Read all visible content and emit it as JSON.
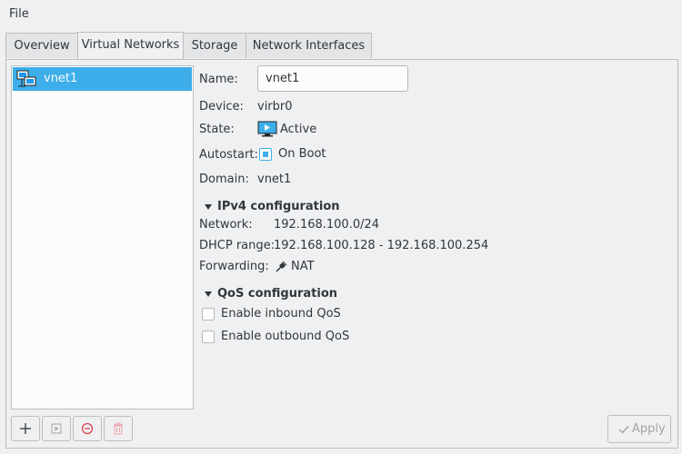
{
  "menubar": {
    "file": "File"
  },
  "tabs": [
    {
      "label": "Overview"
    },
    {
      "label": "Virtual Networks"
    },
    {
      "label": "Storage"
    },
    {
      "label": "Network Interfaces"
    }
  ],
  "networks": [
    {
      "name": "vnet1",
      "icon": "network-icon"
    }
  ],
  "details": {
    "name_label": "Name:",
    "name_value": "vnet1",
    "device_label": "Device:",
    "device_value": "virbr0",
    "state_label": "State:",
    "state_value": "Active",
    "autostart_label": "Autostart:",
    "autostart_value": "On Boot",
    "autostart_checked": true,
    "domain_label": "Domain:",
    "domain_value": "vnet1"
  },
  "ipv4": {
    "heading": "IPv4 configuration",
    "network_label": "Network:",
    "network_value": "192.168.100.0/24",
    "dhcp_label": "DHCP range:",
    "dhcp_value": "192.168.100.128 - 192.168.100.254",
    "forwarding_label": "Forwarding:",
    "forwarding_value": "NAT"
  },
  "qos": {
    "heading": "QoS configuration",
    "inbound_label": "Enable inbound QoS",
    "outbound_label": "Enable outbound QoS"
  },
  "footer": {
    "apply_label": "Apply"
  },
  "colors": {
    "accent": "#3daee9",
    "stop": "#da4453"
  }
}
